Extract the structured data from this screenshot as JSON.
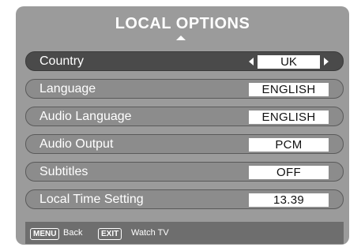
{
  "title": "LOCAL OPTIONS",
  "rows": [
    {
      "label": "Country",
      "value": "UK",
      "selected": true
    },
    {
      "label": "Language",
      "value": "ENGLISH"
    },
    {
      "label": "Audio Language",
      "value": "ENGLISH"
    },
    {
      "label": "Audio Output",
      "value": "PCM"
    },
    {
      "label": "Subtitles",
      "value": "OFF"
    },
    {
      "label": "Local Time Setting",
      "value": "13.39"
    }
  ],
  "footer": {
    "menu_key": "MENU",
    "menu_label": "Back",
    "exit_key": "EXIT",
    "exit_label": "Watch TV"
  },
  "icons": [
    "up-caret-icon",
    "left-arrow-icon",
    "right-arrow-icon"
  ]
}
